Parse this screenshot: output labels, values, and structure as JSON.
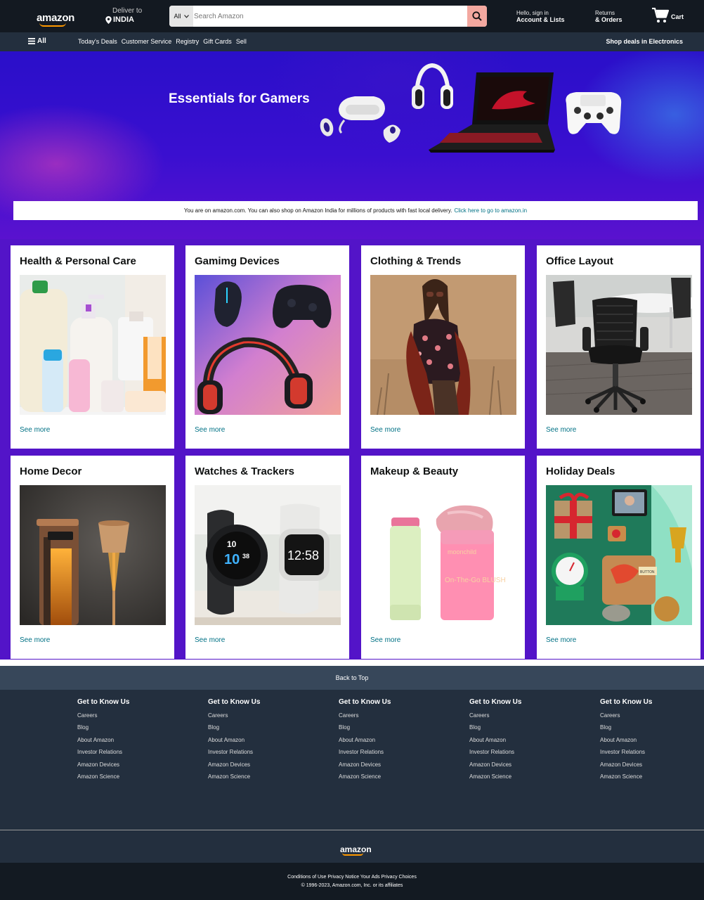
{
  "header": {
    "logo": "amazon",
    "deliver_label": "Deliver to",
    "deliver_location": "INDIA",
    "search_category": "All",
    "search_placeholder": "Search Amazon",
    "account_small": "Hello, sign in",
    "account_big": "Account & Lists",
    "returns_small": "Returns",
    "returns_big": "& Orders",
    "cart_label": "Cart"
  },
  "subnav": {
    "all_label": "All",
    "links": [
      "Today's Deals",
      "Customer Service",
      "Registry",
      "Gift Cards",
      "Sell"
    ],
    "right_link": "Shop deals in Electronics"
  },
  "hero": {
    "title": "Essentials for Gamers",
    "notice_text": "You are on amazon.com. You can also shop on Amazon India for millions of products with fast local delivery.",
    "notice_link": "Click here to go to amazon.in"
  },
  "cards": [
    {
      "title": "Health & Personal Care",
      "link": "See more"
    },
    {
      "title": "Gamimg Devices",
      "link": "See more"
    },
    {
      "title": "Clothing & Trends",
      "link": "See more"
    },
    {
      "title": "Office Layout",
      "link": "See more"
    },
    {
      "title": "Home Decor",
      "link": "See more"
    },
    {
      "title": "Watches & Trackers",
      "link": "See more"
    },
    {
      "title": "Makeup & Beauty",
      "link": "See more"
    },
    {
      "title": "Holiday Deals",
      "link": "See more"
    }
  ],
  "product_labels": {
    "watch_left_top": "10",
    "watch_left_mid": "10",
    "watch_left_sec": "38",
    "watch_right_time": "12:58",
    "makeup_brand": "moonchild",
    "makeup_product": "On-The-Go BLUSH",
    "holiday_tag": "BUTTON"
  },
  "footer": {
    "back_to_top": "Back to Top",
    "columns": [
      {
        "title": "Get to Know Us",
        "items": [
          "Careers",
          "Blog",
          "About Amazon",
          "Investor Relations",
          "Amazon Devices",
          "Amazon Science"
        ]
      },
      {
        "title": "Get to Know Us",
        "items": [
          "Careers",
          "Blog",
          "About Amazon",
          "Investor Relations",
          "Amazon Devices",
          "Amazon Science"
        ]
      },
      {
        "title": "Get to Know Us",
        "items": [
          "Careers",
          "Blog",
          "About Amazon",
          "Investor Relations",
          "Amazon Devices",
          "Amazon Science"
        ]
      },
      {
        "title": "Get to Know Us",
        "items": [
          "Careers",
          "Blog",
          "About Amazon",
          "Investor Relations",
          "Amazon Devices",
          "Amazon Science"
        ]
      },
      {
        "title": "Get to Know Us",
        "items": [
          "Careers",
          "Blog",
          "About Amazon",
          "Investor Relations",
          "Amazon Devices",
          "Amazon Science"
        ]
      }
    ],
    "logo": "amazon",
    "legal_links": "Conditions of Use Privacy Notice Your Ads Privacy Choices",
    "copyright": "© 1996-2023, Amazon.com, Inc. or its affiliates"
  },
  "colors": {
    "nav_bg": "#131921",
    "subnav_bg": "#232f3e",
    "hero_purple": "#3a0fd0",
    "cards_bg": "#5314c8",
    "link": "#007185",
    "accent": "#ff9900"
  },
  "icons": [
    "location-pin-icon",
    "chevron-down-icon",
    "search-icon",
    "cart-icon",
    "hamburger-menu-icon"
  ]
}
